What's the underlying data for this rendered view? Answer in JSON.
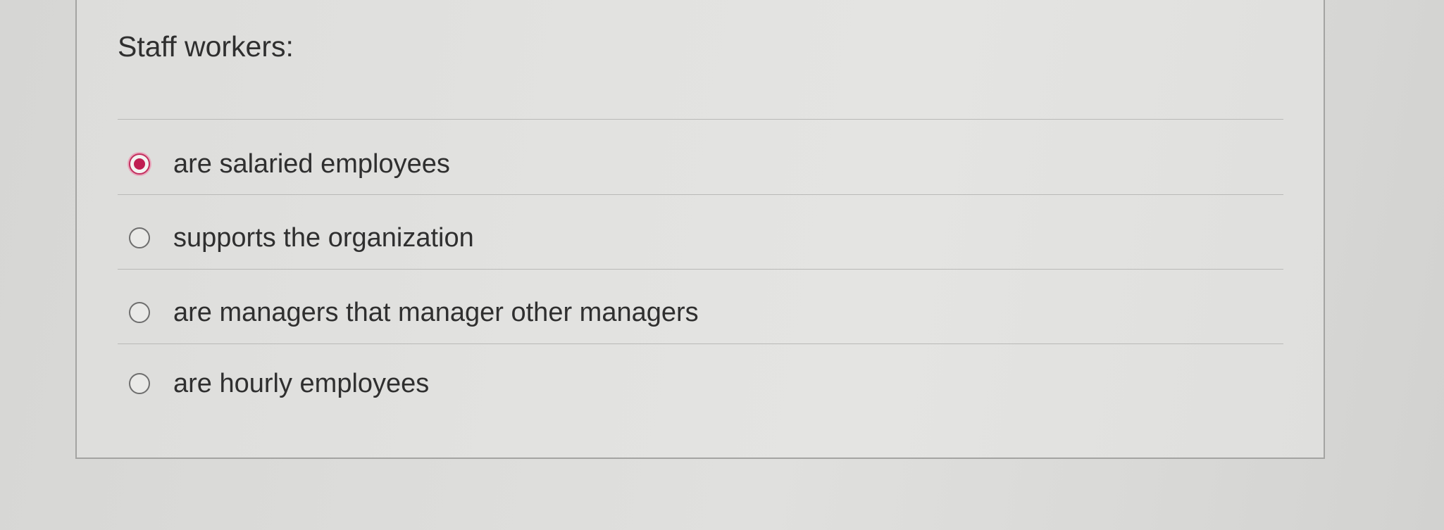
{
  "question": {
    "title": "Staff workers:"
  },
  "options": [
    {
      "label": "are salaried employees",
      "selected": true
    },
    {
      "label": "supports the organization",
      "selected": false
    },
    {
      "label": "are managers that manager other managers",
      "selected": false
    },
    {
      "label": "are hourly employees",
      "selected": false
    }
  ],
  "colors": {
    "selected_radio": "#c01e52",
    "text": "#2f2f2f",
    "divider": "#b9b9b7"
  }
}
